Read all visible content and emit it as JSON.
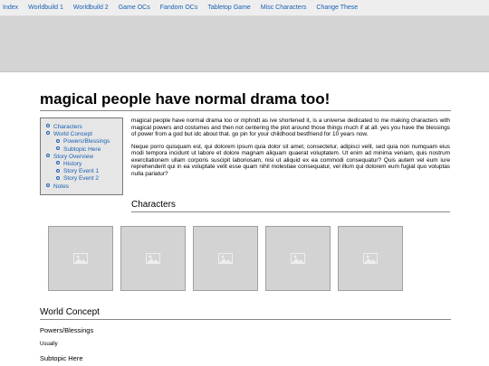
{
  "nav": {
    "items": [
      "Index",
      "Worldbuild 1",
      "Worldbuild 2",
      "Game OCs",
      "Fandom OCs",
      "Tabletop Game",
      "Misc Characters",
      "Change These"
    ]
  },
  "page": {
    "title": "magical people have normal drama too!"
  },
  "toc": {
    "items": [
      {
        "label": "Characters",
        "level": 1
      },
      {
        "label": "World Concept",
        "level": 1
      },
      {
        "label": "Powers/Blessings",
        "level": 2
      },
      {
        "label": "Subtopic Here",
        "level": 2
      },
      {
        "label": "Story Overview",
        "level": 1
      },
      {
        "label": "History",
        "level": 2
      },
      {
        "label": "Story Event 1",
        "level": 2
      },
      {
        "label": "Story Event 2",
        "level": 2
      },
      {
        "label": "Notes",
        "level": 1
      }
    ]
  },
  "intro": {
    "p1": "magical people have normal drama too or mphndt as ive shortened it, is a universe dedicated to me making characters with magical powers and costumes and then not centering the plot around those things much if at all. yes you have the blessings of power from a god but idc about that. go pin for your childhood bestfriend for 10 years now.",
    "p2": "Neque porro quisquam est, qui dolorem ipsum quia dolor sit amet, consectetur, adipisci velit, sed quia non numquam eius modi tempora incidunt ut labore et dolore magnam aliquam quaerat voluptatem. Ut enim ad minima veniam, quis nostrum exercitationem ullam corporis suscipit laboriosam, nisi ut aliquid ex ea commodi consequatur? Quis autem vel eum iure reprehenderit qui in ea voluptate velit esse quam nihil molestiae consequatur, vel illum qui dolorem eum fugiat quo voluptas nulla pariatur?"
  },
  "sections": {
    "characters": "Characters",
    "world_concept": "World Concept",
    "powers": "Powers/Blessings",
    "usually": "Usually",
    "subtopic": "Subtopic Here"
  },
  "characters": {
    "cards": [
      "image-placeholder-icon",
      "image-placeholder-icon",
      "image-placeholder-icon",
      "image-placeholder-icon",
      "image-placeholder-icon"
    ]
  }
}
